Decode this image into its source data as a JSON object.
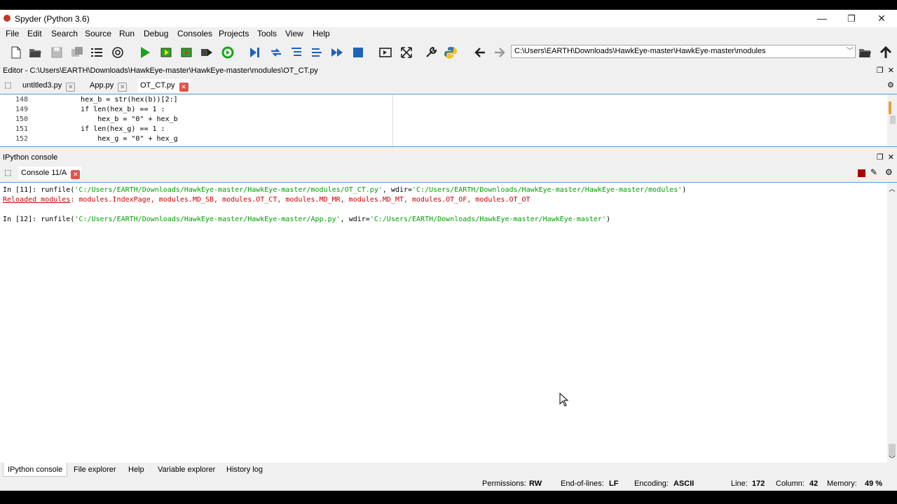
{
  "window": {
    "title": "Spyder (Python 3.6)",
    "minimize_glyph": "—",
    "restore_glyph": "❐",
    "close_glyph": "✕"
  },
  "menu": [
    "File",
    "Edit",
    "Search",
    "Source",
    "Run",
    "Debug",
    "Consoles",
    "Projects",
    "Tools",
    "View",
    "Help"
  ],
  "toolbar": {
    "path": "C:\\Users\\EARTH\\Downloads\\HawkEye-master\\HawkEye-master\\modules",
    "icons": [
      "new-file-icon",
      "open-file-icon",
      "save-icon",
      "save-all-icon",
      "outline-icon",
      "at-icon",
      "run-icon",
      "run-cell-icon",
      "run-cell-advance-icon",
      "run-selection-icon",
      "rerun-icon",
      "debug-icon",
      "step-icon",
      "step-into-icon",
      "step-return-icon",
      "continue-icon",
      "stop-icon",
      "maximize-pane-icon",
      "fullscreen-icon",
      "preferences-icon",
      "python-path-icon",
      "back-arrow-icon",
      "forward-arrow-icon",
      "browse-folder-icon",
      "parent-dir-icon"
    ]
  },
  "editor": {
    "header": "Editor - C:\\Users\\EARTH\\Downloads\\HawkEye-master\\HawkEye-master\\modules\\OT_CT.py",
    "tabs": [
      {
        "label": "untitled3.py",
        "active": false
      },
      {
        "label": "App.py",
        "active": false
      },
      {
        "label": "OT_CT.py",
        "active": true
      }
    ],
    "lines": [
      {
        "num": "148",
        "code": "        hex_b = str(hex(b))[2:]"
      },
      {
        "num": "149",
        "code": "        if len(hex_b) == 1 :"
      },
      {
        "num": "150",
        "code": "            hex_b = \"0\" + hex_b"
      },
      {
        "num": "151",
        "code": "        if len(hex_g) == 1 :"
      },
      {
        "num": "152",
        "code": "            hex_g = \"0\" + hex_g"
      }
    ]
  },
  "console": {
    "header": "IPython console",
    "tab_label": "Console 11/A",
    "lines": [
      {
        "prompt": "In [11]: ",
        "call": "runfile(",
        "arg1": "'C:/Users/EARTH/Downloads/HawkEye-master/HawkEye-master/modules/OT_CT.py'",
        "mid": ", wdir=",
        "arg2": "'C:/Users/EARTH/Downloads/HawkEye-master/HawkEye-master/modules'",
        "end": ")"
      },
      {
        "reload_label": "Reloaded modules",
        "reload_list": ": modules.IndexPage, modules.MD_SB, modules.OT_CT, modules.MD_MR, modules.MD_MT, modules.OT_OF, modules.OT_OT"
      },
      {
        "prompt": "In [12]: ",
        "call": "runfile(",
        "arg1": "'C:/Users/EARTH/Downloads/HawkEye-master/HawkEye-master/App.py'",
        "mid": ", wdir=",
        "arg2": "'C:/Users/EARTH/Downloads/HawkEye-master/HawkEye-master'",
        "end": ")"
      }
    ]
  },
  "bottom_tabs": [
    "IPython console",
    "File explorer",
    "Help",
    "Variable explorer",
    "History log"
  ],
  "status": {
    "permissions_label": "Permissions:",
    "permissions": "RW",
    "eol_label": "End-of-lines:",
    "eol": "LF",
    "encoding_label": "Encoding:",
    "encoding": "ASCII",
    "line_label": "Line:",
    "line": "172",
    "column_label": "Column:",
    "column": "42",
    "memory_label": "Memory:",
    "memory": "49 %"
  },
  "colors": {
    "string_green": "#00a000",
    "reload_red": "#cc0000",
    "run_green": "#1aa31a",
    "focus_blue": "#5b9bd5"
  }
}
